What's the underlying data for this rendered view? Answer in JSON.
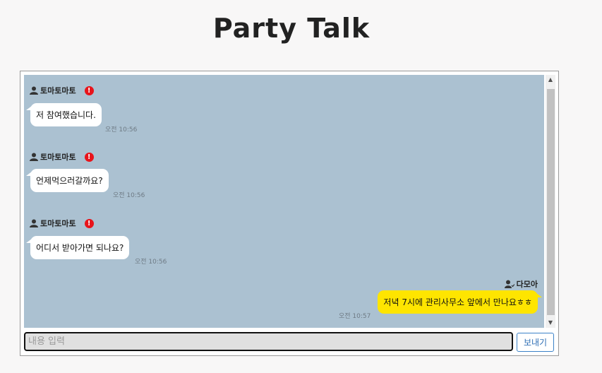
{
  "app": {
    "title": "Party Talk"
  },
  "messages": [
    {
      "sender": "토마토마토",
      "text": "저 참여했습니다.",
      "time": "오전 10:56"
    },
    {
      "sender": "토마토마토",
      "text": "언제먹으러갈까요?",
      "time": "오전 10:56"
    },
    {
      "sender": "토마토마토",
      "text": "어디서 받아가면 되나요?",
      "time": "오전 10:56"
    }
  ],
  "my_message": {
    "sender": "다모아",
    "text": "저녁 7시에 관리사무소 앞에서 만나요ㅎㅎ",
    "time": "오전 10:57"
  },
  "composer": {
    "placeholder": "내용 입력",
    "send_label": "보내기"
  },
  "colors": {
    "chat_bg": "#abc1d1",
    "my_bubble": "#fee500",
    "alert": "#e8141b",
    "send_button": "#2f6fb5"
  },
  "icons": {
    "user": "user-icon",
    "alert": "exclamation-icon",
    "scroll_up": "scroll-up-arrow",
    "scroll_down": "scroll-down-arrow"
  }
}
